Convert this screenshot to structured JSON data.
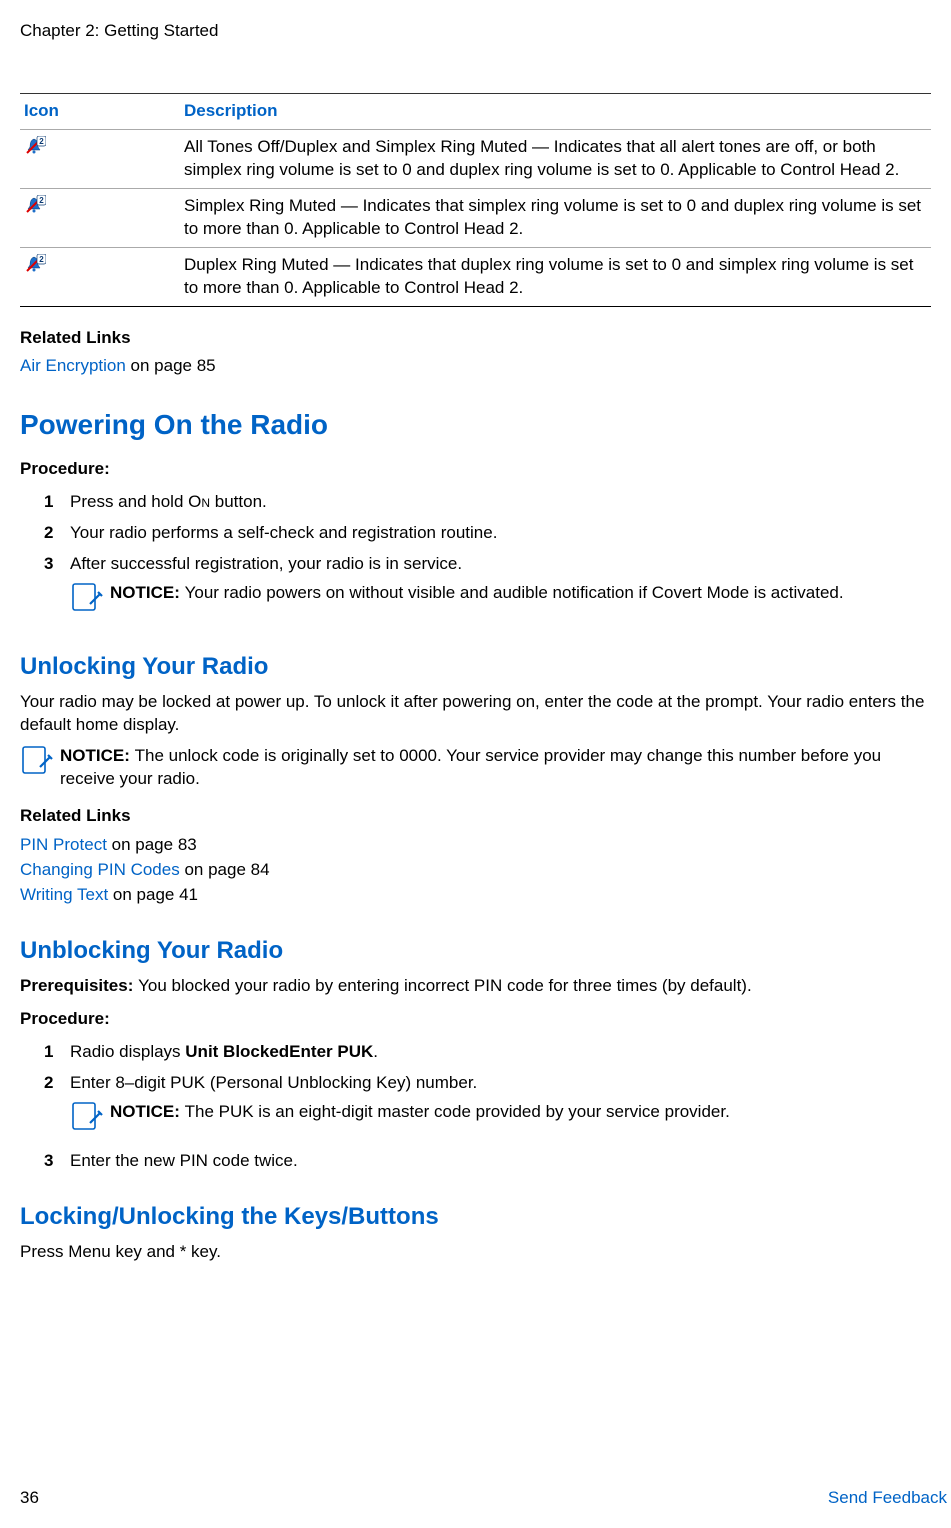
{
  "chapter": "Chapter 2: Getting Started",
  "table": {
    "header_icon": "Icon",
    "header_desc": "Description",
    "rows": [
      {
        "icon": "bell-duplex-simplex",
        "desc": "All Tones Off/Duplex and Simplex Ring Muted — Indicates that all alert tones are off, or both simplex ring volume is set to 0 and duplex ring volume is set to 0. Applicable to Control Head 2."
      },
      {
        "icon": "bell-simplex",
        "desc": "Simplex Ring Muted — Indicates that simplex ring volume is set to 0 and duplex ring volume is set to more than 0. Applicable to Control Head 2."
      },
      {
        "icon": "bell-duplex",
        "desc": "Duplex Ring Muted — Indicates that duplex ring volume is set to 0 and simplex ring volume is set to more than 0. Applicable to Control Head 2."
      }
    ]
  },
  "related1": {
    "heading": "Related Links",
    "link": "Air Encryption",
    "page": " on page 85"
  },
  "powering": {
    "heading": "Powering On the Radio",
    "proc_label": "Procedure:",
    "steps": {
      "s1n": "1",
      "s1a": "Press and hold ",
      "s1b": "On",
      "s1c": " button.",
      "s2n": "2",
      "s2": "Your radio performs a self-check and registration routine.",
      "s3n": "3",
      "s3": "After successful registration, your radio is in service.",
      "notice_b": "NOTICE: ",
      "notice": "Your radio powers on without visible and audible notification if Covert Mode is activated."
    }
  },
  "unlocking": {
    "heading": "Unlocking Your Radio",
    "intro": "Your radio may be locked at power up. To unlock it after powering on, enter the code at the prompt. Your radio enters the default home display.",
    "notice_b": "NOTICE: ",
    "notice": "The unlock code is originally set to 0000. Your service provider may change this number before you receive your radio.",
    "related_heading": "Related Links",
    "links": [
      {
        "text": "PIN Protect",
        "page": " on page 83"
      },
      {
        "text": "Changing PIN Codes",
        "page": " on page 84"
      },
      {
        "text": "Writing Text",
        "page": " on page 41"
      }
    ]
  },
  "unblocking": {
    "heading": "Unblocking Your Radio",
    "prereq_b": "Prerequisites: ",
    "prereq": "You blocked your radio by entering incorrect PIN code for three times (by default).",
    "proc_label": "Procedure:",
    "steps": {
      "s1n": "1",
      "s1a": "Radio displays ",
      "s1b": "Unit BlockedEnter PUK",
      "s1c": ".",
      "s2n": "2",
      "s2": "Enter 8–digit PUK (Personal Unblocking Key) number.",
      "notice_b": "NOTICE: ",
      "notice": "The PUK is an eight-digit master code provided by your service provider.",
      "s3n": "3",
      "s3": "Enter the new PIN code twice."
    }
  },
  "locking": {
    "heading": "Locking/Unlocking the Keys/Buttons",
    "text_a": "Press ",
    "text_b": "Menu",
    "text_c": " key and * key."
  },
  "footer": {
    "page": "36",
    "feedback": "Send Feedback"
  }
}
